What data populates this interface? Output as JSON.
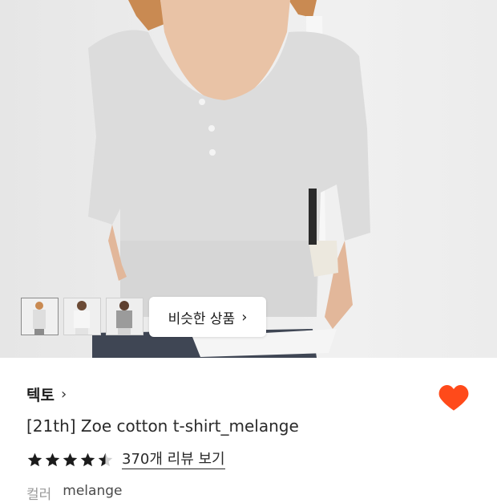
{
  "gallery": {
    "similar_button_label": "비슷한 상품",
    "thumbnails": [
      "thumbnail-1",
      "thumbnail-2",
      "thumbnail-3"
    ]
  },
  "product": {
    "brand": "텍토",
    "title": "[21th] Zoe cotton t-shirt_melange",
    "rating": 4.5,
    "review_link": "370개 리뷰 보기",
    "color_label": "컬러",
    "color_value": "melange",
    "wishlisted": true
  },
  "colors": {
    "heart": "#ff4a1a",
    "text": "#1f1f1f",
    "muted": "#9a9a9a"
  },
  "icons": [
    "chevron-right-icon",
    "heart-icon",
    "star-icon",
    "half-star-icon"
  ]
}
